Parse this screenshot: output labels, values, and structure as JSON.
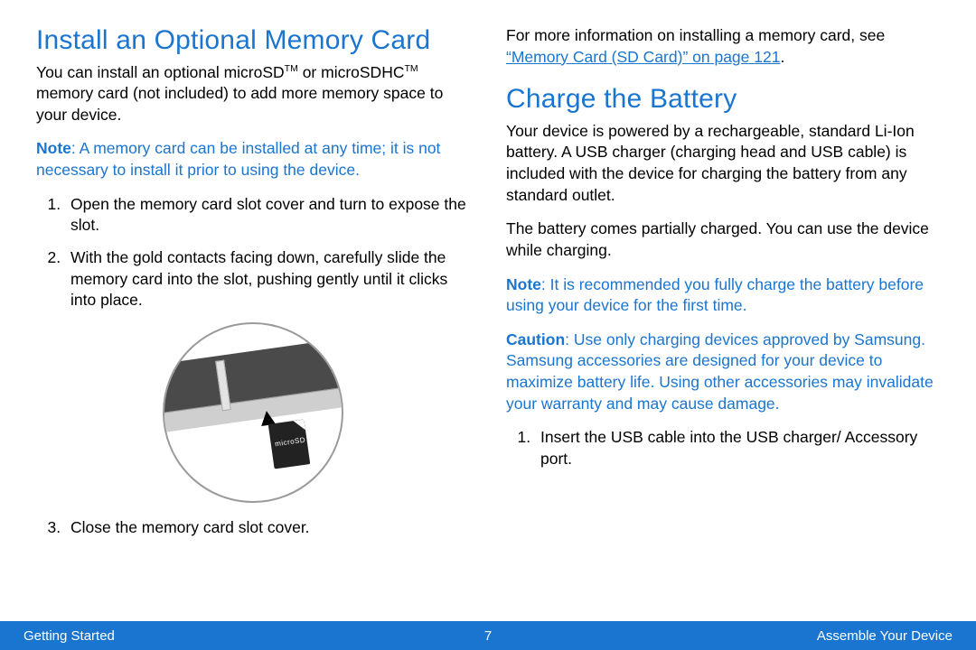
{
  "left": {
    "heading": "Install an Optional Memory Card",
    "intro_a": "You can install an optional microSD",
    "intro_b": " or microSDHC",
    "intro_c": " memory card (not included) to add more memory space to your device.",
    "note_label": "Note",
    "note_text": ": A memory card can be installed at any time; it is not necessary to install it prior to using the device.",
    "steps": {
      "s1": "Open the memory card slot cover and turn to expose the slot.",
      "s2": "With the gold contacts facing down, carefully slide the memory card into the slot, pushing gently until it clicks into place.",
      "s3": "Close the memory card slot cover."
    },
    "sd_label": "microSD"
  },
  "right": {
    "more_info_a": "For more information on installing a memory card, see ",
    "more_info_link": "“Memory Card (SD Card)” on page 121",
    "more_info_b": ".",
    "heading": "Charge the Battery",
    "p1": "Your device is powered by a rechargeable, standard Li-Ion battery. A USB charger (charging head and USB cable) is included with the device for charging the battery from any standard outlet.",
    "p2": "The battery comes partially charged. You can use the device while charging.",
    "note_label": "Note",
    "note_text": ": It is recommended you fully charge the battery before using your device for the first time.",
    "caution_label": "Caution",
    "caution_text": ": Use only charging devices approved by Samsung. Samsung accessories are designed for your device to maximize battery life. Using other accessories may invalidate your warranty and may cause damage.",
    "steps": {
      "s1": "Insert the USB cable into the USB charger/ Accessory port."
    }
  },
  "footer": {
    "left": "Getting Started",
    "center": "7",
    "right": "Assemble Your Device"
  },
  "tm": "TM"
}
